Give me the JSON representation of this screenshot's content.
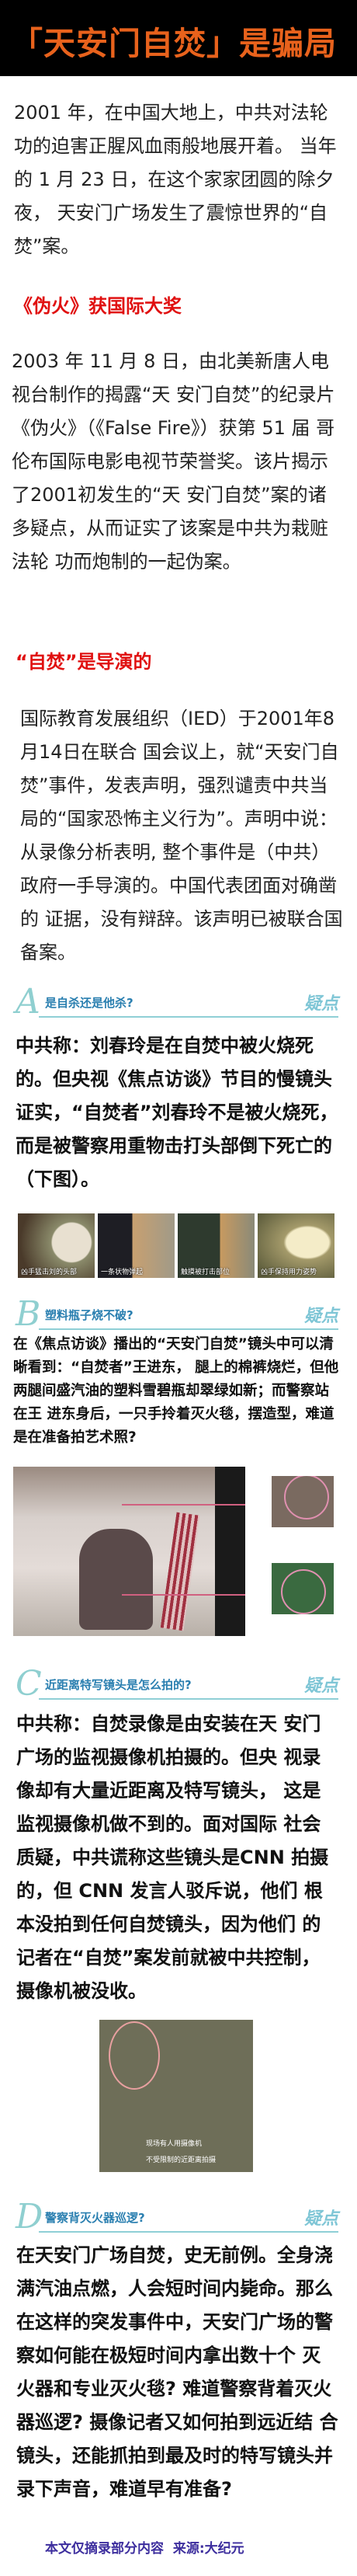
{
  "title": "「天安门自焚」是骗局",
  "intro": "2001 年，在中国大地上，中共对法轮功的迫害正腥风血雨般地展开着。 当年的 1 月 23 日，在这个家家团圆的除夕夜， 天安门广场发生了震惊世界的“自焚”案。",
  "section1": {
    "heading": "《伪火》获国际大奖",
    "body": "2003 年 11 月 8 日，由北美新唐人电视台制作的揭露“天 安门自焚”的纪录片《伪火》（《False Fire》）获第 51 届 哥伦布国际电影电视节荣誉奖。该片揭示了2001初发生的“天 安门自焚”案的诸多疑点，从而证实了该案是中共为栽赃法轮 功而炮制的一起伪案。"
  },
  "section2": {
    "heading": "“自焚”是导演的",
    "body": "国际教育发展组织（IED）于2001年8月14日在联合 国会议上，就“天安门自焚”事件，发表声明，强烈谴责中共当局的“国家恐怖主义行为”。声明中说：从录像分析表明, 整个事件是（中共）政府一手导演的。中国代表团面对确凿的 证据，没有辩辞。该声明已被联合国备案。"
  },
  "questions": [
    {
      "letter": "A",
      "title": "是自杀还是他杀?",
      "tag": "疑点",
      "body": "中共称：刘春玲是在自焚中被火烧死的。但央视《焦点访谈》节目的慢镜头证实，“自焚者”刘春玲不是被火烧死，而是被警察用重物击打头部倒下死亡的（下图）。",
      "captions": [
        "凶手猛击刘的头部",
        "一条状物弹起",
        "触摸被打击部位",
        "凶手保持用力姿势"
      ]
    },
    {
      "letter": "B",
      "title": "塑料瓶子烧不破?",
      "tag": "疑点",
      "body": "在《焦点访谈》播出的“天安门自焚”镜头中可以清晰看到：“自焚者”王进东， 腿上的棉裤烧烂，但他两腿间盛汽油的塑料雪碧瓶却翠绿如新；而警察站在王 进东身后，一只手拎着灭火毯，摆造型，难道是在准备拍艺术照?"
    },
    {
      "letter": "C",
      "title": "近距离特写镜头是怎么拍的?",
      "tag": "疑点",
      "body": "中共称：自焚录像是由安装在天 安门广场的监视摄像机拍摄的。但央 视录像却有大量近距离及特写镜头， 这是监视摄像机做不到的。面对国际 社会质疑，中共谎称这些镜头是CNN 拍摄的，但 CNN 发言人驳斥说，他们 根本没拍到任何自焚镜头，因为他们 的记者在“自焚”案发前就被中共控制，摄像机被没收。",
      "captions": [
        "现场有人用摄像机",
        "不受限制的近距离拍摄"
      ]
    },
    {
      "letter": "D",
      "title": "警察背灭火器巡逻?",
      "tag": "疑点",
      "body": "在天安门广场自焚，史无前例。全身浇满汽油点燃，人会短时间内毙命。那么在这样的突发事件中，天安门广场的警察如何能在极短时间内拿出数十个 灭火器和专业灭火毯? 难道警察背着灭火器巡逻? 摄像记者又如何拍到远近结 合镜头，还能抓拍到最及时的特写镜头并录下声音，难道早有准备?"
    }
  ],
  "footer": "本文仅摘录部分内容  来源:大纪元",
  "colors": {
    "title": "#e8621c",
    "red_heading": "#e01010",
    "accent": "#8fcfd6",
    "footer": "#3d2e9e"
  }
}
